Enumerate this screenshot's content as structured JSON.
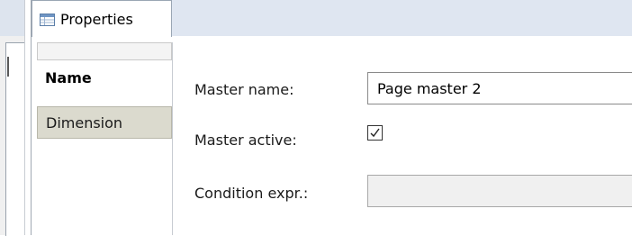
{
  "properties_view": {
    "tab_label": "Properties",
    "tab_icon": "table-icon",
    "sections": [
      {
        "label": "Name",
        "selected": true
      },
      {
        "label": "Dimension",
        "selected": false
      }
    ],
    "form": {
      "master_name_label": "Master name:",
      "master_name_value": "Page master 2",
      "master_active_label": "Master active:",
      "master_active_checked": true,
      "condition_label": "Condition expr.:",
      "condition_value": ""
    }
  },
  "colors": {
    "tabbar_bg": "#dfe6f1",
    "selected_section_bg": "#ffffff",
    "section_bg": "#dbdace"
  }
}
